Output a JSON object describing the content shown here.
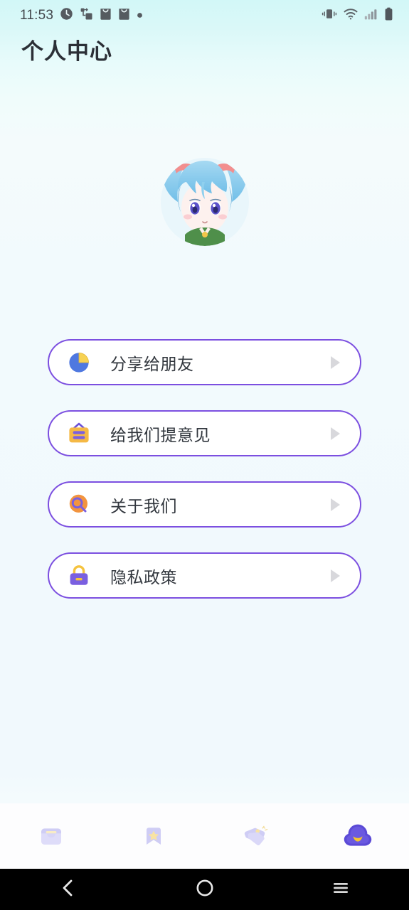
{
  "status_bar": {
    "time": "11:53",
    "left_icons": [
      "alarm-clock-icon",
      "network-share-icon",
      "shopping-bag-icon",
      "shopping-bag-icon",
      "dot-icon"
    ],
    "right_icons": [
      "vibrate-icon",
      "wifi-icon",
      "signal-bars-icon",
      "battery-icon"
    ]
  },
  "header": {
    "title": "个人中心"
  },
  "avatar": {
    "name": "user-avatar",
    "description": "anime-avatar"
  },
  "menu": {
    "items": [
      {
        "label": "分享给朋友",
        "icon": "share-pie-icon",
        "arrow": "chevron-right-icon"
      },
      {
        "label": "给我们提意见",
        "icon": "feedback-board-icon",
        "arrow": "chevron-right-icon"
      },
      {
        "label": "关于我们",
        "icon": "about-search-icon",
        "arrow": "chevron-right-icon"
      },
      {
        "label": "隐私政策",
        "icon": "privacy-lock-icon",
        "arrow": "chevron-right-icon"
      }
    ]
  },
  "tabbar": {
    "items": [
      {
        "name": "tab-inbox",
        "icon": "inbox-box-icon",
        "active": false
      },
      {
        "name": "tab-favorites",
        "icon": "bookmark-star-icon",
        "active": false
      },
      {
        "name": "tab-tags",
        "icon": "price-tags-icon",
        "active": false
      },
      {
        "name": "tab-profile",
        "icon": "cloud-profile-icon",
        "active": true
      }
    ]
  },
  "nav_bar": {
    "back": "back-chevron-icon",
    "home": "home-circle-icon",
    "recents": "recents-menu-icon"
  },
  "colors": {
    "accent_purple": "#7c4fe0",
    "tab_active": "#5b4ad6",
    "tab_inactive": "#cfcdf5",
    "accent_yellow": "#f5c23c",
    "bg_top": "#d2f7f7",
    "bg_bottom": "#f1f9fd",
    "text_dark": "#32373e",
    "arrow_gray": "#d8d8dc"
  }
}
